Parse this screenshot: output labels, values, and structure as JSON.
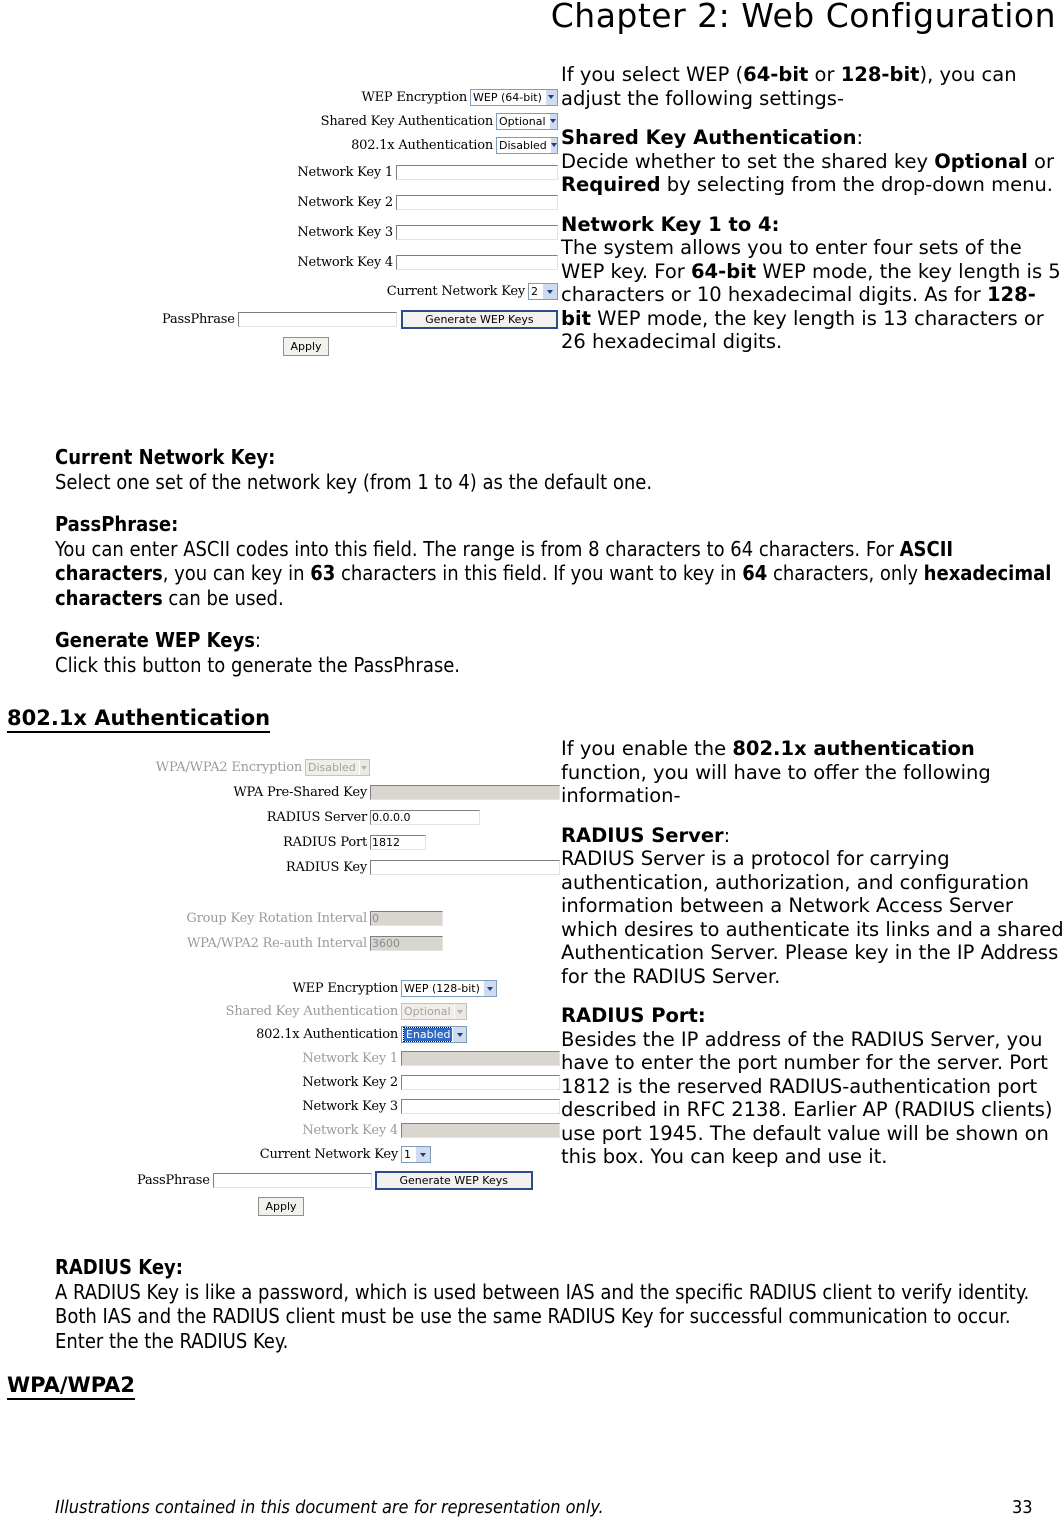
{
  "header": {
    "chapter_title": "Chapter 2: Web Configuration"
  },
  "wep_form": {
    "rows": [
      {
        "label": "WEP Encryption",
        "type": "select",
        "value": "WEP (64-bit)",
        "disabled": false
      },
      {
        "label": "Shared Key Authentication",
        "type": "select",
        "value": "Optional",
        "disabled": false
      },
      {
        "label": "802.1x Authentication",
        "type": "select",
        "value": "Disabled",
        "disabled": false
      },
      {
        "label": "Network Key 1",
        "type": "input",
        "value": "",
        "disabled": false
      },
      {
        "label": "Network Key 2",
        "type": "input",
        "value": "",
        "disabled": false
      },
      {
        "label": "Network Key 3",
        "type": "input",
        "value": "",
        "disabled": false
      },
      {
        "label": "Network Key 4",
        "type": "input",
        "value": "",
        "disabled": false
      },
      {
        "label": "Current Network Key",
        "type": "select",
        "value": "2",
        "disabled": false
      },
      {
        "label": "PassPhrase",
        "type": "input",
        "value": "",
        "disabled": false
      }
    ],
    "generate_button": "Generate WEP Keys",
    "apply_button": "Apply"
  },
  "wep_text": {
    "intro_1": "If you select WEP (",
    "intro_b1": "64-bit",
    "intro_2": " or ",
    "intro_b2": "128-bit",
    "intro_3": "), you can adjust the following settings-",
    "shared_key_heading": "Shared Key Authentication",
    "shared_key_colon": ":",
    "shared_key_t1": "Decide whether to set the shared key ",
    "shared_key_b1": "Optional",
    "shared_key_t2": " or ",
    "shared_key_b2": "Required",
    "shared_key_t3": " by selecting from the drop-down menu.",
    "netkey_heading": "Network Key 1 to 4:",
    "netkey_t1": "The system allows you to enter four sets of the WEP key. For ",
    "netkey_b1": "64-bit",
    "netkey_t2": " WEP mode, the key length is 5 characters or 10 hexadecimal digits. As for ",
    "netkey_b2": "128-bit",
    "netkey_t3": " WEP mode, the key length is 13 characters or 26 hexadecimal digits."
  },
  "current_network_key": {
    "heading": "Current Network Key:",
    "body": "Select one set of the network key (from 1 to 4) as the default one."
  },
  "passphrase": {
    "heading": "PassPhrase:",
    "t1": "You can enter ASCII codes into this field. The range is from 8 characters to 64 characters. For ",
    "b1": "ASCII characters",
    "t2": ", you can key in ",
    "b2": "63",
    "t3": " characters in this field. If you want to key in ",
    "b3": "64",
    "t4": " characters, only ",
    "b4": "hexadecimal characters",
    "t5": " can be used."
  },
  "generate_wep_keys": {
    "heading": "Generate WEP Keys",
    "heading_colon": ":",
    "body": "Click this button to generate the PassPhrase."
  },
  "section_8021x": {
    "heading": "802.1x Authentication"
  },
  "radius_form": {
    "rows": [
      {
        "label": "WPA/WPA2 Encryption",
        "type": "select",
        "value": "Disabled",
        "disabled": true
      },
      {
        "label": "WPA Pre-Shared Key",
        "type": "input",
        "value": "",
        "disabled": true
      },
      {
        "label": "RADIUS Server",
        "type": "input",
        "value": "0.0.0.0",
        "disabled": false
      },
      {
        "label": "RADIUS Port",
        "type": "input",
        "value": "1812",
        "disabled": false
      },
      {
        "label": "RADIUS Key",
        "type": "input",
        "value": "",
        "disabled": false
      }
    ],
    "interval_rows": [
      {
        "label": "Group Key Rotation Interval",
        "type": "input",
        "value": "0",
        "disabled": true
      },
      {
        "label": "WPA/WPA2 Re-auth Interval",
        "type": "input",
        "value": "3600",
        "disabled": true
      }
    ],
    "wep_rows": [
      {
        "label": "WEP Encryption",
        "type": "select",
        "value": "WEP (128-bit)",
        "disabled": false,
        "highlight": false
      },
      {
        "label": "Shared Key Authentication",
        "type": "select",
        "value": "Optional",
        "disabled": true,
        "highlight": false
      },
      {
        "label": "802.1x Authentication",
        "type": "select",
        "value": "Enabled",
        "disabled": false,
        "highlight": true
      },
      {
        "label": "Network Key 1",
        "type": "input",
        "value": "",
        "disabled": true
      },
      {
        "label": "Network Key 2",
        "type": "input",
        "value": "",
        "disabled": false
      },
      {
        "label": "Network Key 3",
        "type": "input",
        "value": "",
        "disabled": false
      },
      {
        "label": "Network Key 4",
        "type": "input",
        "value": "",
        "disabled": true
      },
      {
        "label": "Current Network Key",
        "type": "select",
        "value": "1",
        "disabled": false,
        "highlight": false
      },
      {
        "label": "PassPhrase",
        "type": "input",
        "value": "",
        "disabled": false
      }
    ],
    "generate_button": "Generate WEP Keys",
    "apply_button": "Apply"
  },
  "radius_text": {
    "intro_1": "If you enable the ",
    "intro_b1": "802.1x authentication",
    "intro_2": " function, you will have to offer the following information-",
    "server_heading": "RADIUS Server",
    "server_colon": ":",
    "server_body": "RADIUS Server is a protocol for carrying authentication, authorization, and configuration information between a Network Access Server which desires to authenticate its links and a shared Authentication Server. Please key in the IP Address for the RADIUS Server.",
    "port_heading": "RADIUS Port:",
    "port_body": "Besides the IP address of the RADIUS Server, you have to enter the port number for the server. Port 1812 is the reserved RADIUS-authentication port described in RFC 2138. Earlier AP (RADIUS clients) use port 1945. The default value will be shown on this box. You can keep and use it."
  },
  "radius_key": {
    "heading": "RADIUS Key:",
    "body": "A RADIUS Key is like a password, which is used between IAS and the specific RADIUS client to verify identity. Both IAS and the RADIUS client must be use the same RADIUS Key for successful communication to occur. Enter the the RADIUS Key."
  },
  "section_wpa": {
    "heading": "WPA/WPA2"
  },
  "footer": {
    "note": "Illustrations contained in this document are for representation only.",
    "page_number": "33"
  }
}
